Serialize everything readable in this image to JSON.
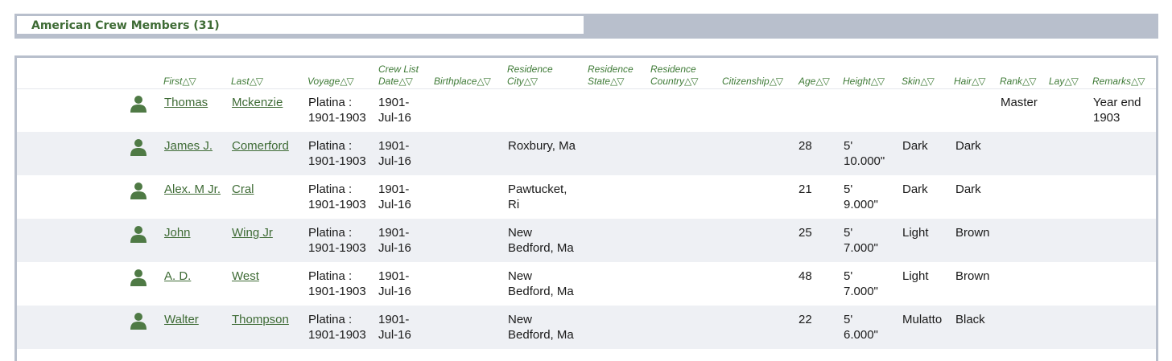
{
  "section": {
    "title": "American Crew Members (31)"
  },
  "sort_glyph": "△▽",
  "columns": {
    "first": "First",
    "last": "Last",
    "voyage": "Voyage",
    "crew_list_date_1": "Crew List",
    "crew_list_date_2": "Date",
    "birthplace": "Birthplace",
    "residence_city_1": "Residence",
    "residence_city_2": "City",
    "residence_state_1": "Residence",
    "residence_state_2": "State",
    "residence_country_1": "Residence",
    "residence_country_2": "Country",
    "citizenship": "Citizenship",
    "age": "Age",
    "height": "Height",
    "skin": "Skin",
    "hair": "Hair",
    "rank": "Rank",
    "lay": "Lay",
    "remarks": "Remarks"
  },
  "rows": [
    {
      "first": "Thomas",
      "last": "Mckenzie",
      "voyage_1": "Platina :",
      "voyage_2": "1901-1903",
      "date_1": "1901-",
      "date_2": "Jul-16",
      "city_1": "",
      "city_2": "",
      "age": "",
      "height_1": "",
      "height_2": "",
      "skin": "",
      "hair": "",
      "rank": "Master",
      "remarks_1": "Year end",
      "remarks_2": "1903"
    },
    {
      "first": "James J.",
      "last": "Comerford",
      "voyage_1": "Platina :",
      "voyage_2": "1901-1903",
      "date_1": "1901-",
      "date_2": "Jul-16",
      "city_1": "Roxbury, Ma",
      "city_2": "",
      "age": "28",
      "height_1": "5'",
      "height_2": "10.000\"",
      "skin": "Dark",
      "hair": "Dark",
      "rank": "",
      "remarks_1": "",
      "remarks_2": ""
    },
    {
      "first": "Alex. M Jr.",
      "last": "Cral",
      "voyage_1": "Platina :",
      "voyage_2": "1901-1903",
      "date_1": "1901-",
      "date_2": "Jul-16",
      "city_1": "Pawtucket,",
      "city_2": "Ri",
      "age": "21",
      "height_1": "5'",
      "height_2": "9.000\"",
      "skin": "Dark",
      "hair": "Dark",
      "rank": "",
      "remarks_1": "",
      "remarks_2": ""
    },
    {
      "first": "John",
      "last": "Wing Jr",
      "voyage_1": "Platina :",
      "voyage_2": "1901-1903",
      "date_1": "1901-",
      "date_2": "Jul-16",
      "city_1": "New",
      "city_2": "Bedford, Ma",
      "age": "25",
      "height_1": "5'",
      "height_2": "7.000\"",
      "skin": "Light",
      "hair": "Brown",
      "rank": "",
      "remarks_1": "",
      "remarks_2": ""
    },
    {
      "first": "A. D.",
      "last": "West",
      "voyage_1": "Platina :",
      "voyage_2": "1901-1903",
      "date_1": "1901-",
      "date_2": "Jul-16",
      "city_1": "New",
      "city_2": "Bedford, Ma",
      "age": "48",
      "height_1": "5'",
      "height_2": "7.000\"",
      "skin": "Light",
      "hair": "Brown",
      "rank": "",
      "remarks_1": "",
      "remarks_2": ""
    },
    {
      "first": "Walter",
      "last": "Thompson",
      "voyage_1": "Platina :",
      "voyage_2": "1901-1903",
      "date_1": "1901-",
      "date_2": "Jul-16",
      "city_1": "New",
      "city_2": "Bedford, Ma",
      "age": "22",
      "height_1": "5'",
      "height_2": "6.000\"",
      "skin": "Mulatto",
      "hair": "Black",
      "rank": "",
      "remarks_1": "",
      "remarks_2": ""
    }
  ]
}
